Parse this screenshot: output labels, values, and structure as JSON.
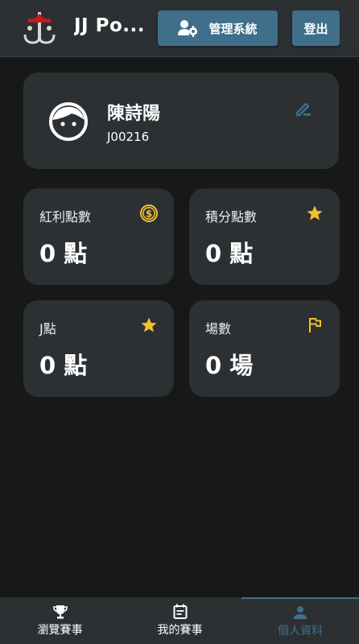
{
  "header": {
    "app_title": "JJ Po...",
    "admin_button_label": "管理系統",
    "logout_button_label": "登出"
  },
  "profile": {
    "name": "陳詩陽",
    "member_id": "J00216"
  },
  "stats": [
    {
      "label": "紅利點數",
      "value": "0 點",
      "icon": "dollar-coin-icon"
    },
    {
      "label": "積分點數",
      "value": "0 點",
      "icon": "star-icon"
    },
    {
      "label": "J點",
      "value": "0 點",
      "icon": "star-icon"
    },
    {
      "label": "場數",
      "value": "0 場",
      "icon": "flag-icon"
    }
  ],
  "bottom_nav": [
    {
      "label": "瀏覽賽事",
      "icon": "trophy-icon",
      "active": false
    },
    {
      "label": "我的賽事",
      "icon": "calendar-note-icon",
      "active": false
    },
    {
      "label": "個人資料",
      "icon": "person-icon",
      "active": true
    }
  ],
  "colors": {
    "background": "#171818",
    "surface": "#2c3033",
    "accent": "#3f6f8a",
    "icon_gold": "#f1c02c"
  }
}
